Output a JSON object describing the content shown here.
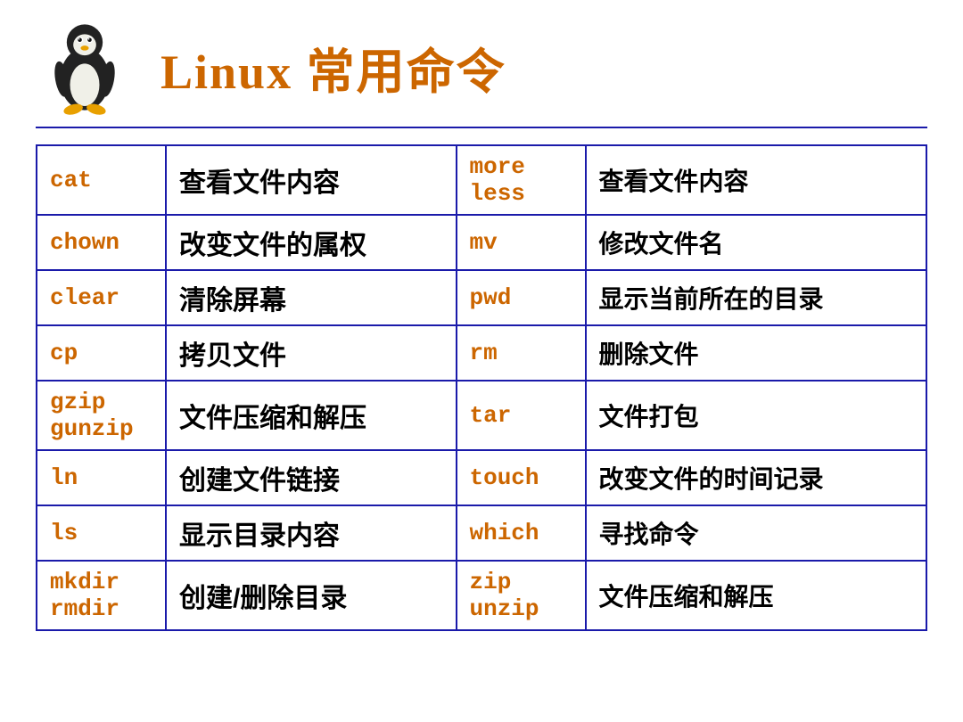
{
  "header": {
    "title": "Linux 常用命令"
  },
  "table": {
    "rows": [
      {
        "cmd1": "cat",
        "desc1": "查看文件内容",
        "cmd2": "more\nless",
        "desc2": "查看文件内容"
      },
      {
        "cmd1": "chown",
        "desc1": "改变文件的属权",
        "cmd2": "mv",
        "desc2": "修改文件名"
      },
      {
        "cmd1": "clear",
        "desc1": "清除屏幕",
        "cmd2": "pwd",
        "desc2": "显示当前所在的目录"
      },
      {
        "cmd1": "cp",
        "desc1": "拷贝文件",
        "cmd2": "rm",
        "desc2": "删除文件"
      },
      {
        "cmd1": "gzip\ngunzip",
        "desc1": "文件压缩和解压",
        "cmd2": "tar",
        "desc2": "文件打包"
      },
      {
        "cmd1": "ln",
        "desc1": "创建文件链接",
        "cmd2": "touch",
        "desc2": "改变文件的时间记录"
      },
      {
        "cmd1": "ls",
        "desc1": "显示目录内容",
        "cmd2": "which",
        "desc2": "寻找命令"
      },
      {
        "cmd1": "mkdir\nrmdir",
        "desc1": "创建/删除目录",
        "cmd2": "zip\nunzip",
        "desc2": "文件压缩和解压"
      }
    ]
  }
}
